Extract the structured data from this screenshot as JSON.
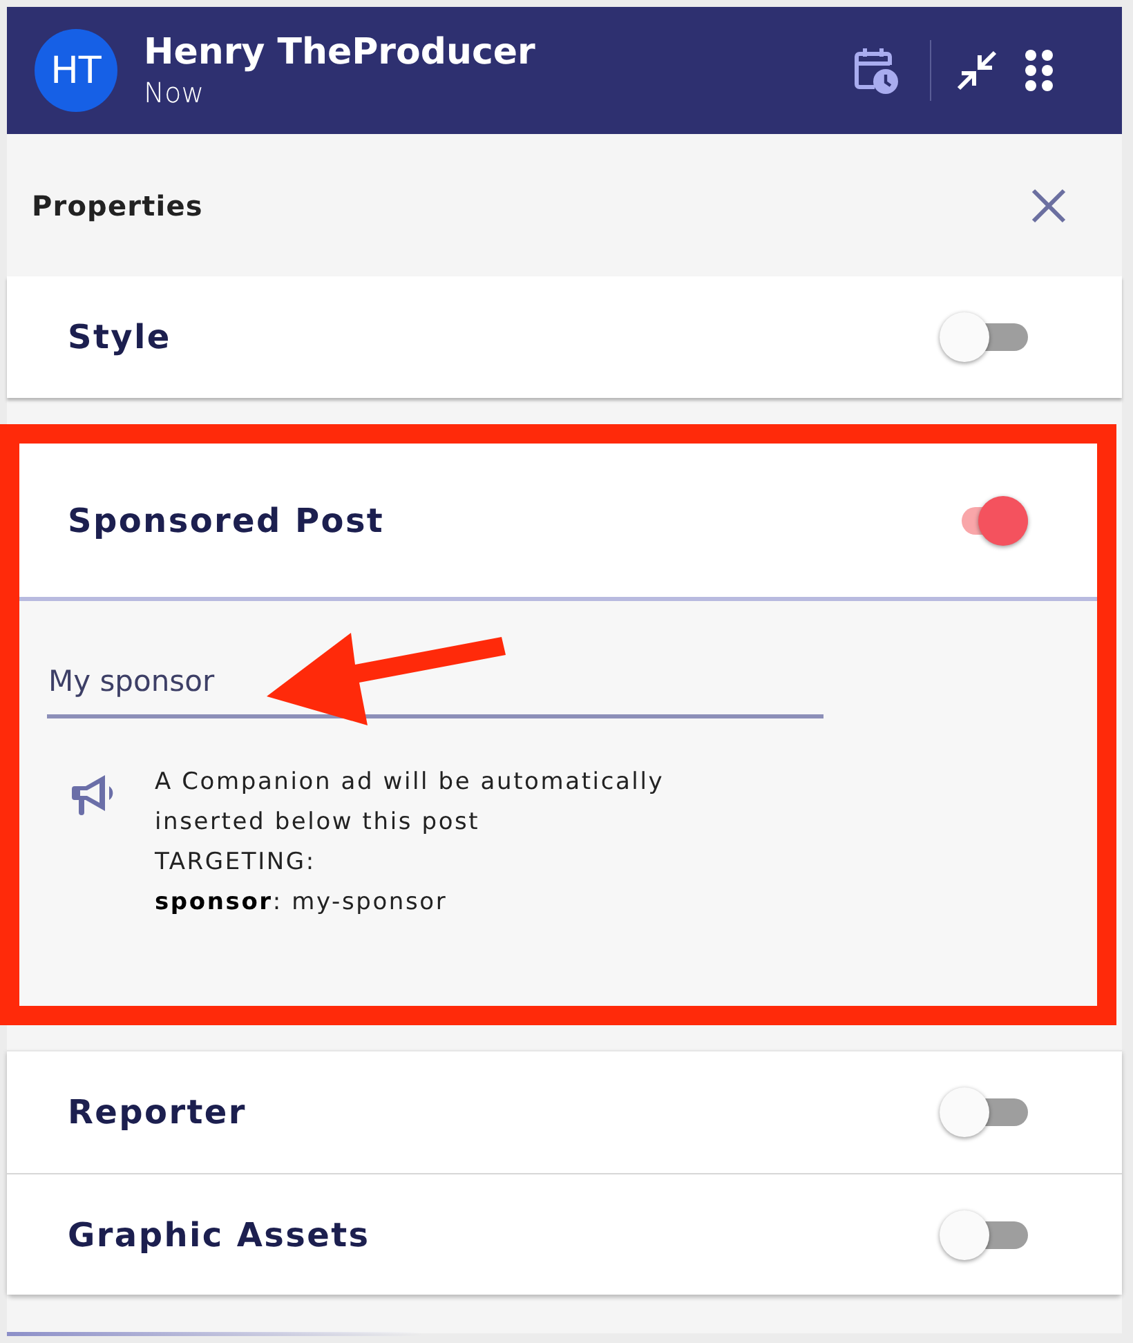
{
  "header": {
    "avatar": "HT",
    "name": "Henry TheProducer",
    "time": "Now"
  },
  "properties": {
    "title": "Properties"
  },
  "sections": [
    {
      "title": "Style",
      "on": false,
      "highlighted": false
    },
    {
      "title": "Sponsored Post",
      "on": true,
      "highlighted": true,
      "field": {
        "value": "My sponsor"
      },
      "info": {
        "lines": [
          "A Companion ad will be automatically inserted below this post",
          "TARGETING:",
          "**sponsor**: my-sponsor"
        ]
      }
    },
    {
      "title": "Reporter",
      "on": false,
      "highlighted": false
    },
    {
      "title": "Graphic Assets",
      "on": false,
      "highlighted": false
    }
  ]
}
